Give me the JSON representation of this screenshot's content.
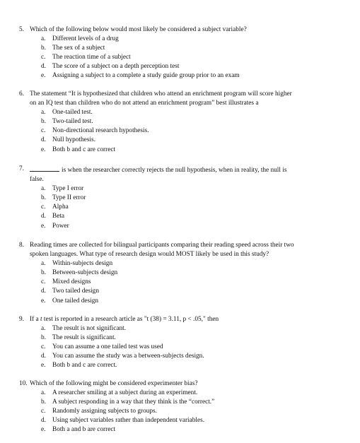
{
  "questions": [
    {
      "number": "5.",
      "text": "Which of the following below would most likely be considered a subject variable?",
      "options": [
        {
          "letter": "a.",
          "text": "Different levels of a drug"
        },
        {
          "letter": "b.",
          "text": "The sex of a subject"
        },
        {
          "letter": "c.",
          "text": "The reaction time of a subject"
        },
        {
          "letter": "d.",
          "text": "The score of a subject on a depth perception test"
        },
        {
          "letter": "e.",
          "text": "Assigning a subject to a complete a study guide group prior to an exam"
        }
      ]
    },
    {
      "number": "6.",
      "text_line1": "The statement “It is hypothesized that children who attend an enrichment program will score higher",
      "text_line2": "on an IQ test than children who do not attend an enrichment program” best illustrates a",
      "options": [
        {
          "letter": "a.",
          "text": "One-tailed test."
        },
        {
          "letter": "b.",
          "text": "Two-tailed test."
        },
        {
          "letter": "c.",
          "text": "Non-directional research hypothesis."
        },
        {
          "letter": "d.",
          "text": "Null hypothesis."
        },
        {
          "letter": "e.",
          "text": "Both b and c are correct"
        }
      ]
    },
    {
      "number": "7.",
      "text_line1": "is when the researcher correctly rejects the null hypothesis, when in reality, the null is",
      "text_line2": "false.",
      "options": [
        {
          "letter": "a.",
          "text": "Type I error"
        },
        {
          "letter": "b.",
          "text": "Type II error"
        },
        {
          "letter": "c.",
          "text": "Alpha"
        },
        {
          "letter": "d.",
          "text": "Beta"
        },
        {
          "letter": "e.",
          "text": "Power"
        }
      ]
    },
    {
      "number": "8.",
      "text_line1": "Reading times are collected for bilingual participants comparing their reading speed across their two",
      "text_line2": "spoken languages. What type of research design would MOST likely be used in this study?",
      "options": [
        {
          "letter": "a.",
          "text": "Within-subjects design"
        },
        {
          "letter": "b.",
          "text": "Between-subjects design"
        },
        {
          "letter": "c.",
          "text": "Mixed designs"
        },
        {
          "letter": "d.",
          "text": "Two tailed design"
        },
        {
          "letter": "e.",
          "text": "One tailed design"
        }
      ]
    },
    {
      "number": "9.",
      "text_pre": "If a ",
      "text_italic": "t",
      "text_post": " test is reported in a research article as \"t (38) = 3.11, p < .05,\" then",
      "options": [
        {
          "letter": "a.",
          "text": "The result is not significant."
        },
        {
          "letter": "b.",
          "text": "The result is significant."
        },
        {
          "letter": "c.",
          "text": "You can assume a one tailed test was used"
        },
        {
          "letter": "d.",
          "text": "You can assume the study was a between-subjects design."
        },
        {
          "letter": "e.",
          "text": "Both b and c are correct."
        }
      ]
    },
    {
      "number": "10.",
      "text": "Which of the following might be considered experimenter bias?",
      "options": [
        {
          "letter": "a.",
          "text": "A researcher smiling at a subject during an experiment."
        },
        {
          "letter": "b.",
          "text": "A subject responding in a way that they think is the “correct.”"
        },
        {
          "letter": "c.",
          "text": "Randomly assigning subjects to groups."
        },
        {
          "letter": "d.",
          "text": "Using subject variables rather than independent variables."
        },
        {
          "letter": "e.",
          "text": "Both a and b are correct"
        }
      ]
    }
  ]
}
